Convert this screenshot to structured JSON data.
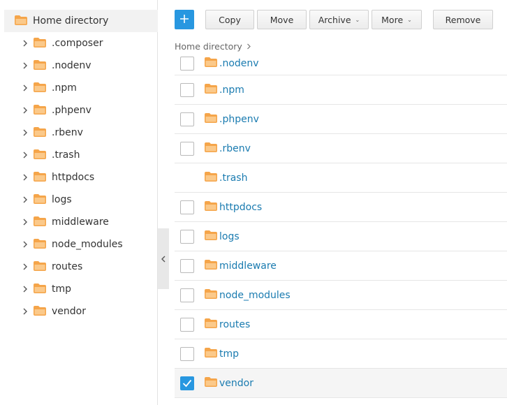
{
  "sidebar": {
    "root_label": "Home directory",
    "items": [
      {
        "label": ".composer"
      },
      {
        "label": ".nodenv"
      },
      {
        "label": ".npm"
      },
      {
        "label": ".phpenv"
      },
      {
        "label": ".rbenv"
      },
      {
        "label": ".trash"
      },
      {
        "label": "httpdocs"
      },
      {
        "label": "logs"
      },
      {
        "label": "middleware"
      },
      {
        "label": "node_modules"
      },
      {
        "label": "routes"
      },
      {
        "label": "tmp"
      },
      {
        "label": "vendor"
      }
    ]
  },
  "toolbar": {
    "add_icon": "plus-icon",
    "copy_label": "Copy",
    "move_label": "Move",
    "archive_label": "Archive",
    "more_label": "More",
    "remove_label": "Remove"
  },
  "breadcrumb": {
    "label": "Home directory",
    "separator": ">"
  },
  "files": [
    {
      "name": ".nodenv",
      "checked": false,
      "has_checkbox": true
    },
    {
      "name": ".npm",
      "checked": false,
      "has_checkbox": true
    },
    {
      "name": ".phpenv",
      "checked": false,
      "has_checkbox": true
    },
    {
      "name": ".rbenv",
      "checked": false,
      "has_checkbox": true
    },
    {
      "name": ".trash",
      "checked": false,
      "has_checkbox": false
    },
    {
      "name": "httpdocs",
      "checked": false,
      "has_checkbox": true
    },
    {
      "name": "logs",
      "checked": false,
      "has_checkbox": true
    },
    {
      "name": "middleware",
      "checked": false,
      "has_checkbox": true
    },
    {
      "name": "node_modules",
      "checked": false,
      "has_checkbox": true
    },
    {
      "name": "routes",
      "checked": false,
      "has_checkbox": true
    },
    {
      "name": "tmp",
      "checked": false,
      "has_checkbox": true
    },
    {
      "name": "vendor",
      "checked": true,
      "has_checkbox": true
    }
  ],
  "colors": {
    "accent": "#2897e0",
    "folder": "#f5a54a",
    "link": "#1a7bb0"
  }
}
